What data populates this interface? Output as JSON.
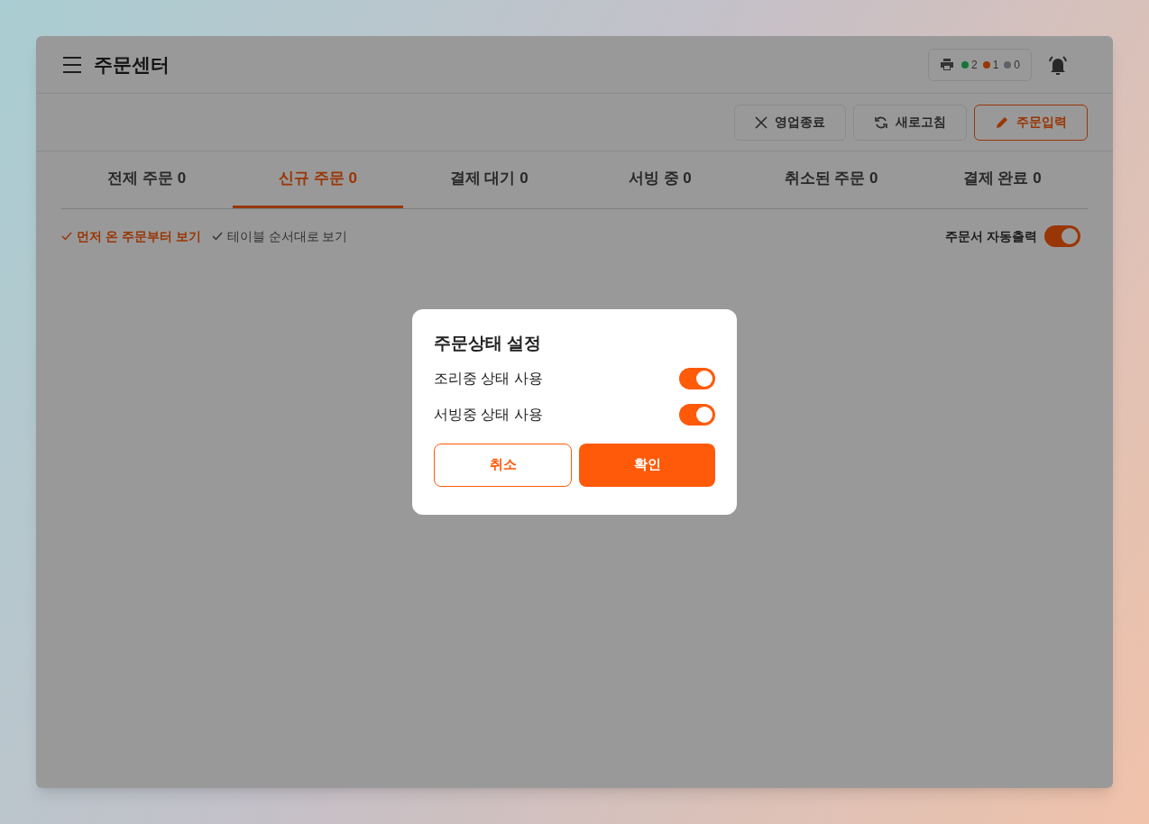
{
  "header": {
    "title": "주문센터",
    "printers": [
      {
        "color": "#147638",
        "count": "2"
      },
      {
        "color": "#993606",
        "count": "1"
      },
      {
        "color": "#5e6269",
        "count": "0"
      }
    ]
  },
  "toolbar": {
    "buttons": [
      {
        "kind": "close",
        "label": "영업종료"
      },
      {
        "kind": "refresh",
        "label": "새로고침"
      },
      {
        "kind": "edit",
        "label": "주문입력"
      }
    ]
  },
  "tabs": [
    {
      "label": "전제 주문 0",
      "selected": false
    },
    {
      "label": "신규 주문 0",
      "selected": true
    },
    {
      "label": "결제 대기 0",
      "selected": false
    },
    {
      "label": "서빙 중 0",
      "selected": false
    },
    {
      "label": "취소된 주문 0",
      "selected": false
    },
    {
      "label": "결제 완료 0",
      "selected": false
    }
  ],
  "sort_options": [
    {
      "label": "먼저 온 주문부터 보기",
      "selected": true
    },
    {
      "label": "테이블 순서대로 보기",
      "selected": false
    }
  ],
  "auto_print": {
    "label": "주문서 자동출력",
    "on": true
  },
  "dialog": {
    "title": "주문상태 설정",
    "settings": [
      {
        "label": "조리중 상태 사용",
        "on": true
      },
      {
        "label": "서빙중 상태 사용",
        "on": true
      }
    ],
    "cancel": "취소",
    "confirm": "확인"
  }
}
